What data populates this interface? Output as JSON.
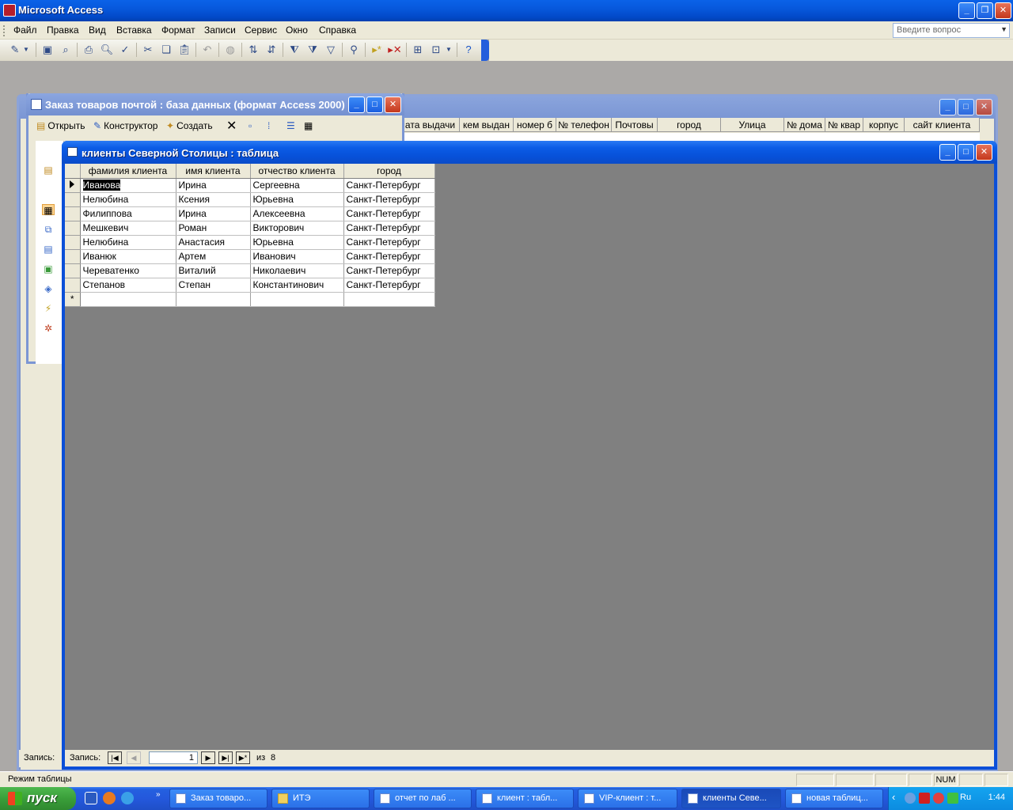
{
  "app": {
    "title": "Microsoft Access"
  },
  "menu": {
    "items": [
      "Файл",
      "Правка",
      "Вид",
      "Вставка",
      "Формат",
      "Записи",
      "Сервис",
      "Окно",
      "Справка"
    ],
    "help_placeholder": "Введите вопрос"
  },
  "db_window": {
    "title": "Заказ товаров почтой : база данных (формат Access 2000)",
    "tools": {
      "open": "Открыть",
      "design": "Конструктор",
      "create": "Создать"
    }
  },
  "bg_table": {
    "columns": [
      "ата выдачи",
      "кем выдан",
      "номер б",
      "№ телефон",
      "Почтовы",
      "город",
      "Улица",
      "№ дома",
      "№ квар",
      "корпус",
      "сайт клиента"
    ],
    "record_label": "Запись:"
  },
  "table_window": {
    "title": "клиенты Северной Столицы : таблица",
    "columns": [
      "фамилия клиента",
      "имя клиента",
      "отчество клиента",
      "город"
    ],
    "rows": [
      [
        "Иванова",
        "Ирина",
        "Сергеевна",
        "Санкт-Петербург"
      ],
      [
        "Нелюбина",
        "Ксения",
        "Юрьевна",
        "Санкт-Петербург"
      ],
      [
        "Филиппова",
        "Ирина",
        "Алексеевна",
        "Санкт-Петербург"
      ],
      [
        "Мешкевич",
        "Роман",
        "Викторович",
        "Санкт-Петербург"
      ],
      [
        "Нелюбина",
        "Анастасия",
        "Юрьевна",
        "Санкт-Петербург"
      ],
      [
        "Иванюк",
        "Артем",
        "Иванович",
        "Санкт-Петербург"
      ],
      [
        "Череватенко",
        "Виталий",
        "Николаевич",
        "Санкт-Петербург"
      ],
      [
        "Степанов",
        "Степан",
        "Константинович",
        "Санкт-Петербург"
      ]
    ],
    "new_row_marker": "*",
    "nav": {
      "record_label": "Запись:",
      "current": "1",
      "of_label": "из",
      "total": "8"
    }
  },
  "statusbar": {
    "mode": "Режим таблицы",
    "num": "NUM"
  },
  "taskbar": {
    "start": "пуск",
    "tasks": [
      "Заказ товаро...",
      "ИТЭ",
      "отчет по лаб ...",
      "клиент : табл...",
      "VIP-клиент : т...",
      "клиенты Севе...",
      "новая таблиц..."
    ],
    "lang": "Ru",
    "clock": "1:44"
  },
  "colors": {
    "xp_blue": "#0a5ce6",
    "face": "#ece9d8",
    "workspace": "#808080",
    "start_green": "#3a9e3a"
  }
}
